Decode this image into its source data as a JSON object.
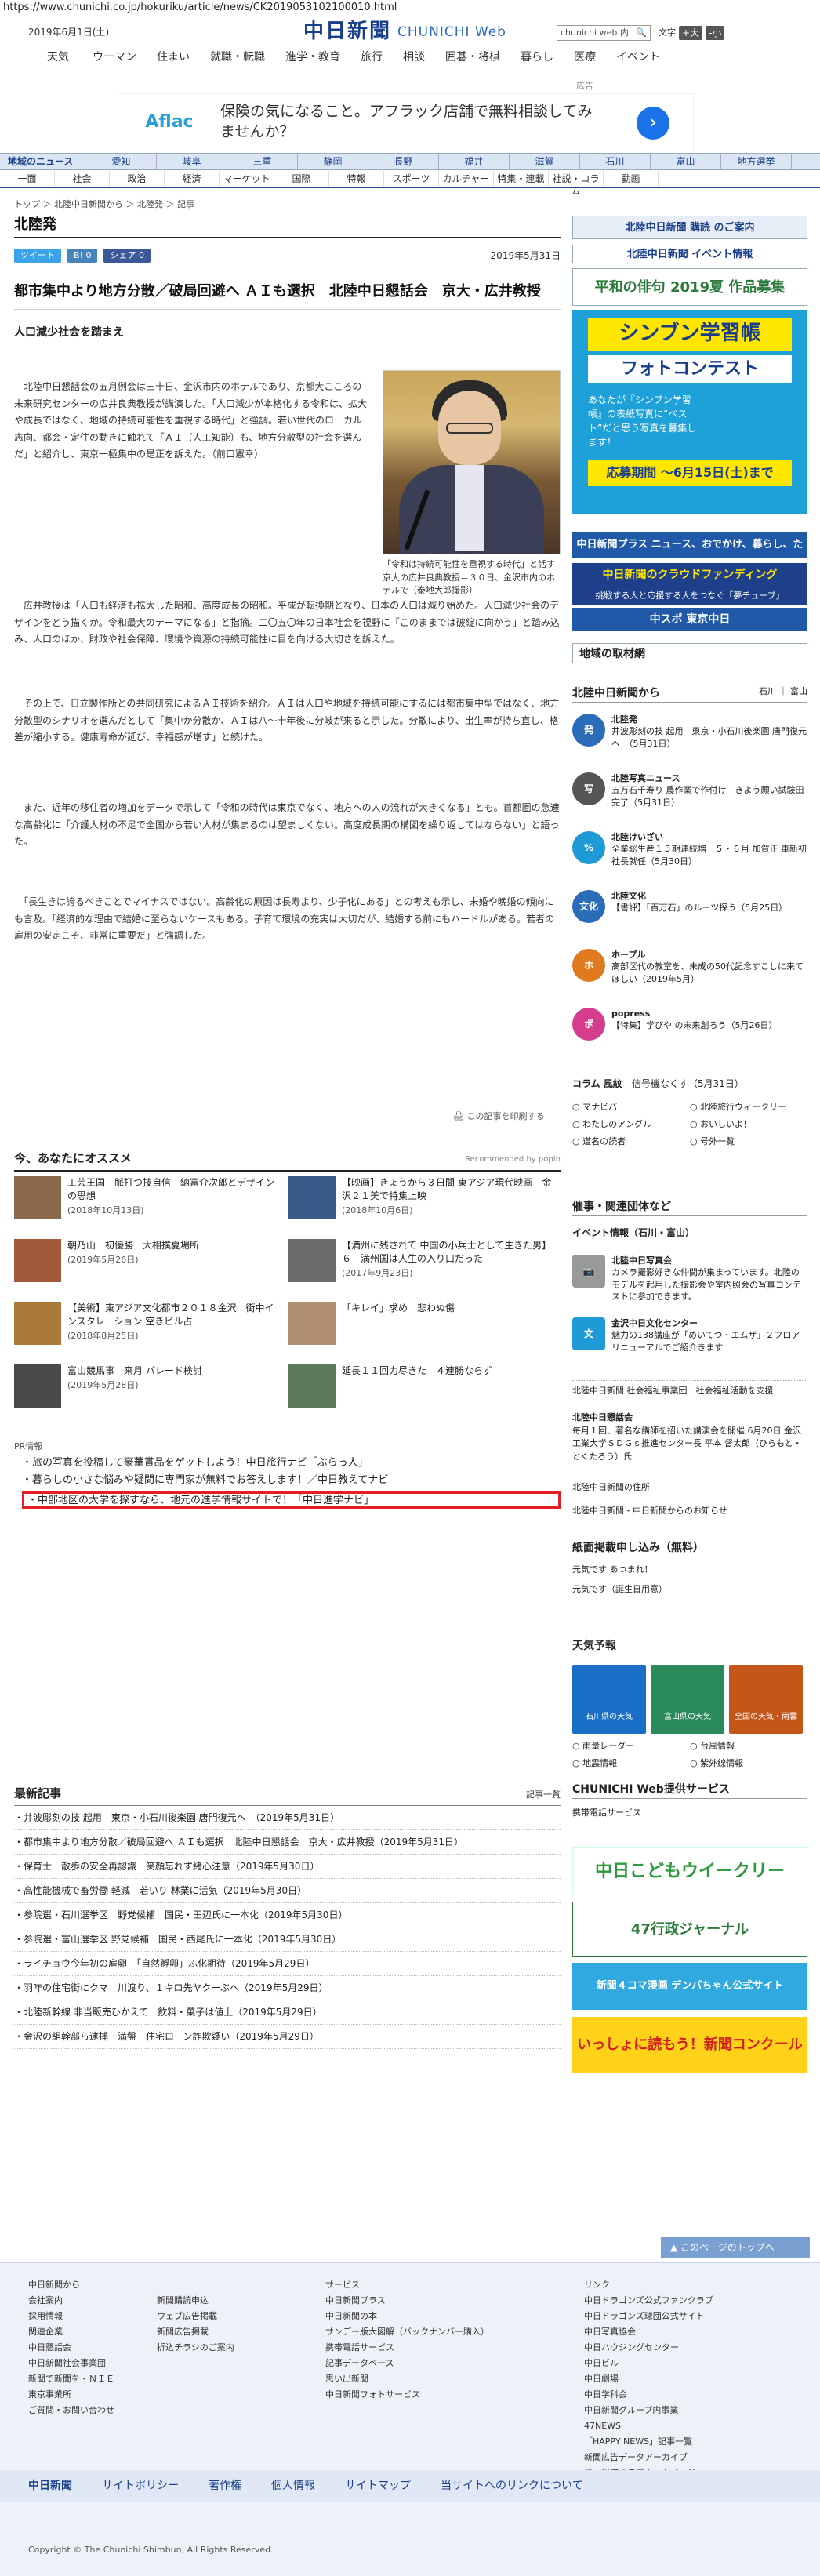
{
  "browser": {
    "url": "https://www.chunichi.co.jp/hokuriku/article/news/CK2019053102100010.html"
  },
  "header": {
    "date": "2019年6月1日(土)",
    "logo_jp": "中日新聞",
    "logo_en": "CHUNICHI Web",
    "search_placeholder": "chunichi web 内",
    "search_icon": "search-icon",
    "fontsize_label": "文字",
    "fontsize_plus": "+大",
    "fontsize_minus": "-小",
    "nav": [
      "天気",
      "ウーマン",
      "住まい",
      "就職・転職",
      "進学・教育",
      "旅行",
      "相談",
      "囲碁・将棋",
      "暮らし",
      "医療",
      "イベント"
    ]
  },
  "ad": {
    "note": "広告",
    "brand": "Aflac",
    "text": "保険の気になること。アフラック店舗で無料相談してみませんか？",
    "arrow": "›"
  },
  "nav1": [
    "地域のニュース",
    "愛知",
    "岐阜",
    "三重",
    "静岡",
    "長野",
    "福井",
    "滋賀",
    "石川",
    "富山",
    "地方選挙"
  ],
  "nav2": [
    "一面",
    "社会",
    "政治",
    "経済",
    "マーケット",
    "国際",
    "特報",
    "スポーツ",
    "カルチャー",
    "特集・連載",
    "社説・コラム",
    "動画"
  ],
  "breadcrumb": "トップ ＞ 北陸中日新聞から ＞ 北陸発 ＞ 記事",
  "article": {
    "section": "北陸発",
    "share": {
      "twitter": "ツイート",
      "hatena": "B! 0",
      "facebook": "シェア 0"
    },
    "date": "2019年5月31日",
    "headline": "都市集中より地方分散／破局回避へ ＡＩも選択　北陸中日懇話会　京大・広井教授",
    "subhead": "人口減少社会を踏まえ",
    "lead": "　北陸中日懇話会の五月例会は三十日、金沢市内のホテルであり、京都大こころの未来研究センターの広井良典教授が講演した。「人口減少が本格化する令和は、拡大や成長ではなく、地域の持続可能性を重視する時代」と強調。若い世代のローカル志向、都会・定住の動きに触れて「ＡＩ（人工知能）も、地方分散型の社会を選んだ」と紹介し、東京一極集中の是正を訴えた。（前口憲幸）",
    "caption": "「令和は持続可能性を重視する時代」と話す京大の広井良典教授＝３０日、金沢市内のホテルで（泰地大郎撮影）",
    "paras": [
      "　広井教授は「人口も経済も拡大した昭和、高度成長の昭和。平成が転換期となり、日本の人口は減り始めた。人口減少社会のデザインをどう描くか。令和最大のテーマになる」と指摘。二〇五〇年の日本社会を視野に「このままでは破綻に向かう」と踏み込み、人口のほか、財政や社会保障、環境や資源の持続可能性に目を向ける大切さを訴えた。",
      "　その上で、日立製作所との共同研究によるＡＩ技術を紹介。ＡＩは人口や地域を持続可能にするには都市集中型ではなく、地方分散型のシナリオを選んだとして「集中か分散か、ＡＩは八～十年後に分岐が来ると示した。分散により、出生率が持ち直し、格差が縮小する。健康寿命が延び、幸福感が増す」と続けた。",
      "　また、近年の移住者の増加をデータで示して「令和の時代は東京でなく、地方への人の流れが大きくなる」とも。首都圏の急速な高齢化に「介護人材の不足で全国から若い人材が集まるのは望ましくない。高度成長期の構図を繰り返してはならない」と語った。",
      "　「長生きは誇るべきことでマイナスではない。高齢化の原因は長寿より、少子化にある」との考えも示し、未婚や晩婚の傾向にも言及。「経済的な理由で結婚に至らないケースもある。子育て環境の充実は大切だが、結婚する前にもハードルがある。若者の雇用の安定こそ、非常に重要だ」と強調した。"
    ],
    "print": "この記事を印刷する"
  },
  "reco": {
    "title": "今、あなたにオススメ",
    "by": "Recommended by popIn",
    "items": [
      {
        "t": "工芸王国　脈打つ技自信　納富介次郎とデザインの思想",
        "d": "(2018年10月13日)"
      },
      {
        "t": "【映画】きょうから３日間 東アジア現代映画　金沢２１美で特集上映",
        "d": "(2018年10月6日)"
      },
      {
        "t": "朝乃山　初優勝　大相撲夏場所",
        "d": "(2019年5月26日)"
      },
      {
        "t": "【満州に残されて 中国の小兵士として生きた男】６　満州国は人生の入り口だった",
        "d": "(2017年9月23日)"
      },
      {
        "t": "【美術】東アジア文化都市２０１８金沢　街中インスタレーション 空きビル占",
        "d": "(2018年8月25日)"
      },
      {
        "t": "「キレイ」求め　悲わぬ傷",
        "d": ""
      },
      {
        "t": "富山競馬事　来月 パレード検討",
        "d": "(2019年5月28日)"
      },
      {
        "t": "延長１１回力尽きた　４連勝ならず",
        "d": ""
      }
    ]
  },
  "pr": {
    "label": "PR情報",
    "items": [
      "旅の写真を投稿して豪華賞品をゲットしよう！中日旅行ナビ「ぶらっ人」",
      "暮らしの小さな悩みや疑問に専門家が無料でお答えします！／中日教えてナビ",
      "中部地区の大学を探すなら、地元の進学情報サイトで！「中日進学ナビ」"
    ]
  },
  "latest": {
    "title": "最新記事",
    "more": "記事一覧",
    "items": [
      "井波彫刻の技 起用　東京・小石川後楽園 唐門復元へ　（2019年5月31日）",
      "都市集中より地方分散／破局回避へ ＡＩも選択　北陸中日懇話会　京大・広井教授（2019年5月31日）",
      "保育士　散歩の安全再認識　笑顔忘れず緒心注意（2019年5月30日）",
      "高性能機械で畜労働 軽減　若いり 林業に活気（2019年5月30日）",
      "参院選・石川選挙区　野党候補　国民・田辺氏に一本化（2019年5月30日）",
      "参院選・富山選挙区 野党候補　国民・西尾氏に一本化（2019年5月30日）",
      "ライチョウ今年初の雇卵　「自然孵卵」ふ化期待（2019年5月29日）",
      "羽咋の住宅街にクマ　川渡り、１キロ先ヤクーぶへ（2019年5月29日）",
      "北陸新幹線 非当販売ひかえて　飲料・菓子は値上（2019年5月29日）",
      "金沢の組幹部ら逮捕　満盤　住宅ローン詐欺疑い（2019年5月29日）"
    ]
  },
  "side": {
    "subscribe": "北陸中日新聞 購読 のご案内",
    "event": "北陸中日新聞 イベント情報",
    "haiku": "平和の俳句 2019夏 作品募集",
    "photo_contest": {
      "title": "シンブン学習帳",
      "sub": "フォトコンテスト",
      "desc": "あなたが『シンブン学習帳』の表紙写真に“ベスト”だと思う写真を募集します！",
      "deadline": "応募期間 ～6月15日(土)まで"
    },
    "plus": "中日新聞プラス ニュース、おでかけ、暮らし、ため！",
    "crowd": "中日新聞のクラウドファンディング",
    "crowd_sub": "挑戦する人と応援する人をつなぐ「夢チューブ」",
    "sports": "中スポ 東京中日",
    "local": "地域の取材網",
    "from_title": "北陸中日新聞から",
    "from_links": "石川 ｜ 富山",
    "from_items": [
      {
        "icon": "発",
        "color": "#2a6cb8",
        "title": "北陸発",
        "text": "井波彫刻の技 起用　東京・小石川後楽園 唐門復元へ　（5月31日）"
      },
      {
        "icon": "写",
        "color": "#555",
        "title": "北陸写真ニュース",
        "text": "五万石千寿り 農作業で作付け　きよう願い試験田完了（5月31日）"
      },
      {
        "icon": "%",
        "color": "#1e9ad6",
        "title": "北陸けいざい",
        "text": "全業総生産１５期連続増　５・６月 加賀正 車新初社長就任（5月30日）"
      },
      {
        "icon": "文化",
        "color": "#2a6cb8",
        "title": "北陸文化",
        "text": "【書評】「百万石」のルーツ探う（5月25日）"
      },
      {
        "icon": "ホ",
        "color": "#e07a1f",
        "title": "ホープル",
        "text": "高部区代の教室を、未成の50代記念すこしに来てほしい（2019年5月）"
      },
      {
        "icon": "ポ",
        "color": "#d63c8c",
        "title": "popress",
        "text": "【特集】学びや の未来創ろう（5月26日）"
      }
    ],
    "column": "コラム 風紋",
    "column_text": "信号機なくす（5月31日）",
    "links": [
      "マナビバ",
      "北陸旅行ウィークリー",
      "わたしのアングル",
      "おいしいよ！",
      "道名の読者",
      "号外一覧"
    ],
    "events_title": "催事・関連団体など",
    "ev_head": "イベント情報（石川・富山）",
    "ev_items": [
      {
        "title": "北陸中日写真会",
        "text": "カメラ撮影好きな仲間が集まっています。北陸のモデルを起用した撮影会や室内照会の写真コンテストに参加できます。"
      },
      {
        "title": "金沢中日文化センター",
        "text": "魅力の138講座が「めいてつ・エムザ」２フロアリニューアルでご紹介きます"
      }
    ],
    "assoc": "北陸中日新聞 社会福祉事業団　社会福祉活動を支援",
    "kondan": "北陸中日懇話会",
    "kondan_text": "毎月１回、著名な講師を招いた講演会を開催 6月20日 金沢工業大学ＳＤＧｓ推進センター長 平本 督太郎（ひらもと・とくたろう）氏",
    "koudoku": "北陸中日新聞の住所",
    "news": "北陸中日新聞・中日新聞からのお知らせ",
    "form_title": "紙面掲載申し込み（無料）",
    "form_items": [
      "元気です あつまれ！",
      "元気です（誕生日用意）"
    ],
    "weather": "天気予報",
    "weather_items": [
      "石川県の天気",
      "富山県の天気",
      "全国の天気・雨雲"
    ],
    "weather_links": [
      "雨量レーダー",
      "台風情報",
      "地震情報",
      "紫外線情報"
    ],
    "services": "CHUNICHI Web提供サービス",
    "services_item": "携帯電話サービス",
    "kodomo": "中日こどもウイークリー",
    "gyosei": "47行政ジャーナル",
    "denpachan": "新聞４コマ漫画 デンパちゃん公式サイト",
    "contest": "いっしょに読もう！新聞コンクール"
  },
  "pagetop": "このページのトップへ",
  "footer": {
    "col1": [
      "中日新聞から",
      "会社案内",
      "採用情報",
      "関連企業",
      "中日懇話会",
      "中日新聞社会事業団",
      "新聞で新聞を・ＮＩＥ",
      "東京事業所",
      "ご質問・お問い合わせ"
    ],
    "col2": [
      "新聞購読申込",
      "ウェブ広告掲載",
      "新聞広告掲載",
      "折込チラシのご案内"
    ],
    "col3": [
      "サービス",
      "中日新聞プラス",
      "中日新聞の本",
      "サンデー版大図解（バックナンバー購入）",
      "携帯電話サービス",
      "記事データベース",
      "思い出新聞",
      "中日新聞フォトサービス"
    ],
    "col4": [
      "リンク",
      "中日ドラゴンズ公式ファンクラブ",
      "中日ドラゴンズ球団公式サイト",
      "中日写真協会",
      "中日ハウジングセンター",
      "中日ビル",
      "中日劇場",
      "中日学科会",
      "中日新聞グループ内事業",
      "47NEWS",
      "「HAPPY NEWS」記事一覧",
      "新聞広告データアーカイブ",
      "日本経済クラブホームページ"
    ],
    "bottom": [
      "中日新聞",
      "サイトポリシー",
      "著作権",
      "個人情報",
      "サイトマップ",
      "当サイトへのリンクについて"
    ],
    "copyright": "Copyright © The Chunichi Shimbun, All Rights Reserved."
  }
}
